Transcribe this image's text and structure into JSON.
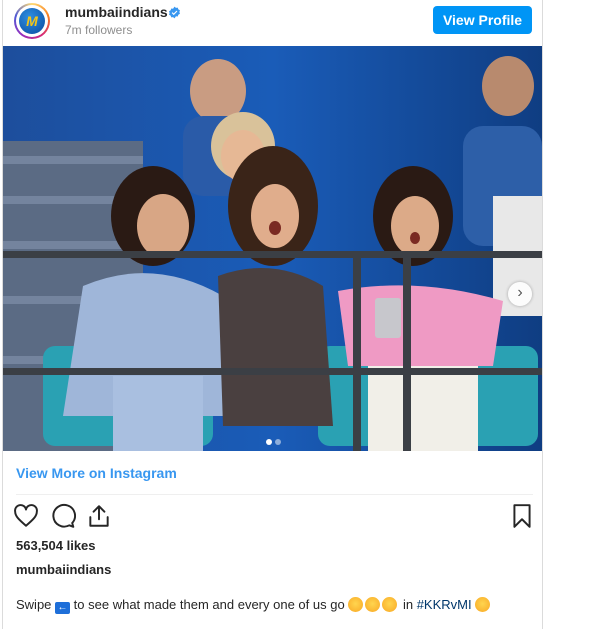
{
  "header": {
    "username": "mumbaiindians",
    "followers": "7m followers",
    "view_profile_label": "View Profile",
    "avatar_letter": "M"
  },
  "post": {
    "view_more_label": "View More on Instagram",
    "likes": "563,504 likes",
    "caption_user": "mumbaiindians",
    "caption_before": "Swipe",
    "caption_middle": "to see what made them and every one of us go",
    "caption_in": "in",
    "hashtag": "#KKRvMI",
    "carousel_index": 1,
    "carousel_total": 2
  },
  "icons": {
    "like": "heart-icon",
    "comment": "comment-icon",
    "share": "share-icon",
    "save": "bookmark-icon",
    "next": "chevron-right-icon",
    "verified": "verified-badge-icon"
  },
  "colors": {
    "accent": "#0095f6",
    "link": "#3897f0",
    "hashtag": "#00376b",
    "text": "#262626",
    "muted": "#8e8e8e"
  }
}
